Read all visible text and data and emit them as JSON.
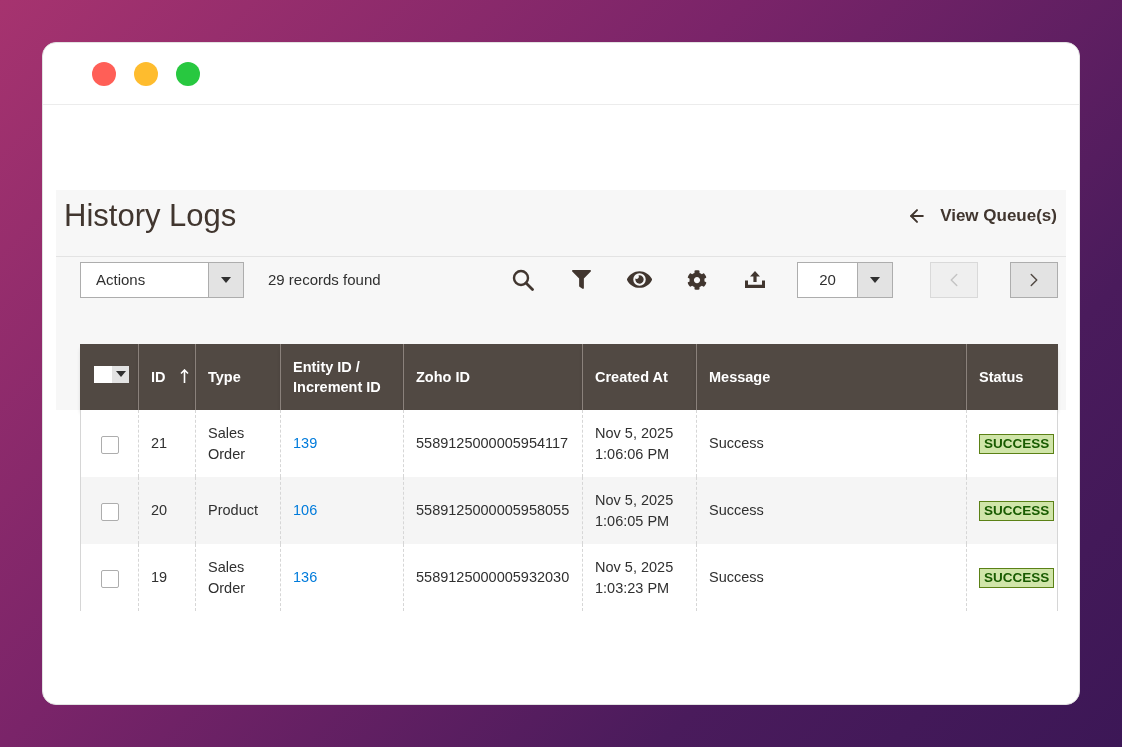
{
  "window": {
    "controls": [
      {
        "color": "#ff5f57"
      },
      {
        "color": "#febc2e"
      },
      {
        "color": "#28c840"
      }
    ]
  },
  "page": {
    "title": "History Logs",
    "back_link": "View Queue(s)"
  },
  "toolbar": {
    "actions_select": "Actions",
    "records_found": "29 records found",
    "tools": [
      {
        "kind": "search"
      },
      {
        "kind": "filter"
      },
      {
        "kind": "columns"
      },
      {
        "kind": "settings"
      },
      {
        "kind": "export"
      }
    ],
    "page_size": "20",
    "previous_page": {
      "disabled": true
    },
    "next_page": {
      "disabled": false
    }
  },
  "table": {
    "select_all": {
      "checked": false
    },
    "columns": [
      {
        "label": "ID",
        "sorted": true
      },
      {
        "label": "Type",
        "sorted": false
      },
      {
        "label": "Entity ID / Increment ID",
        "sorted": false
      },
      {
        "label": "Zoho ID",
        "sorted": false
      },
      {
        "label": "Created At",
        "sorted": false
      },
      {
        "label": "Message",
        "sorted": false
      },
      {
        "label": "Status",
        "sorted": false
      }
    ],
    "rows": [
      {
        "selected": false,
        "id": "21",
        "type": "Sales Order",
        "entity_id": "139",
        "zoho_id": "5589125000005954117",
        "created_at": "Nov 5, 2025 1:06:06 PM",
        "message": "Success",
        "status": "SUCCESS"
      },
      {
        "selected": false,
        "id": "20",
        "type": "Product",
        "entity_id": "106",
        "zoho_id": "5589125000005958055",
        "created_at": "Nov 5, 2025 1:06:05 PM",
        "message": "Success",
        "status": "SUCCESS"
      },
      {
        "selected": false,
        "id": "19",
        "type": "Sales Order",
        "entity_id": "136",
        "zoho_id": "5589125000005932030",
        "created_at": "Nov 5, 2025 1:03:23 PM",
        "message": "Success",
        "status": "SUCCESS"
      }
    ]
  }
}
